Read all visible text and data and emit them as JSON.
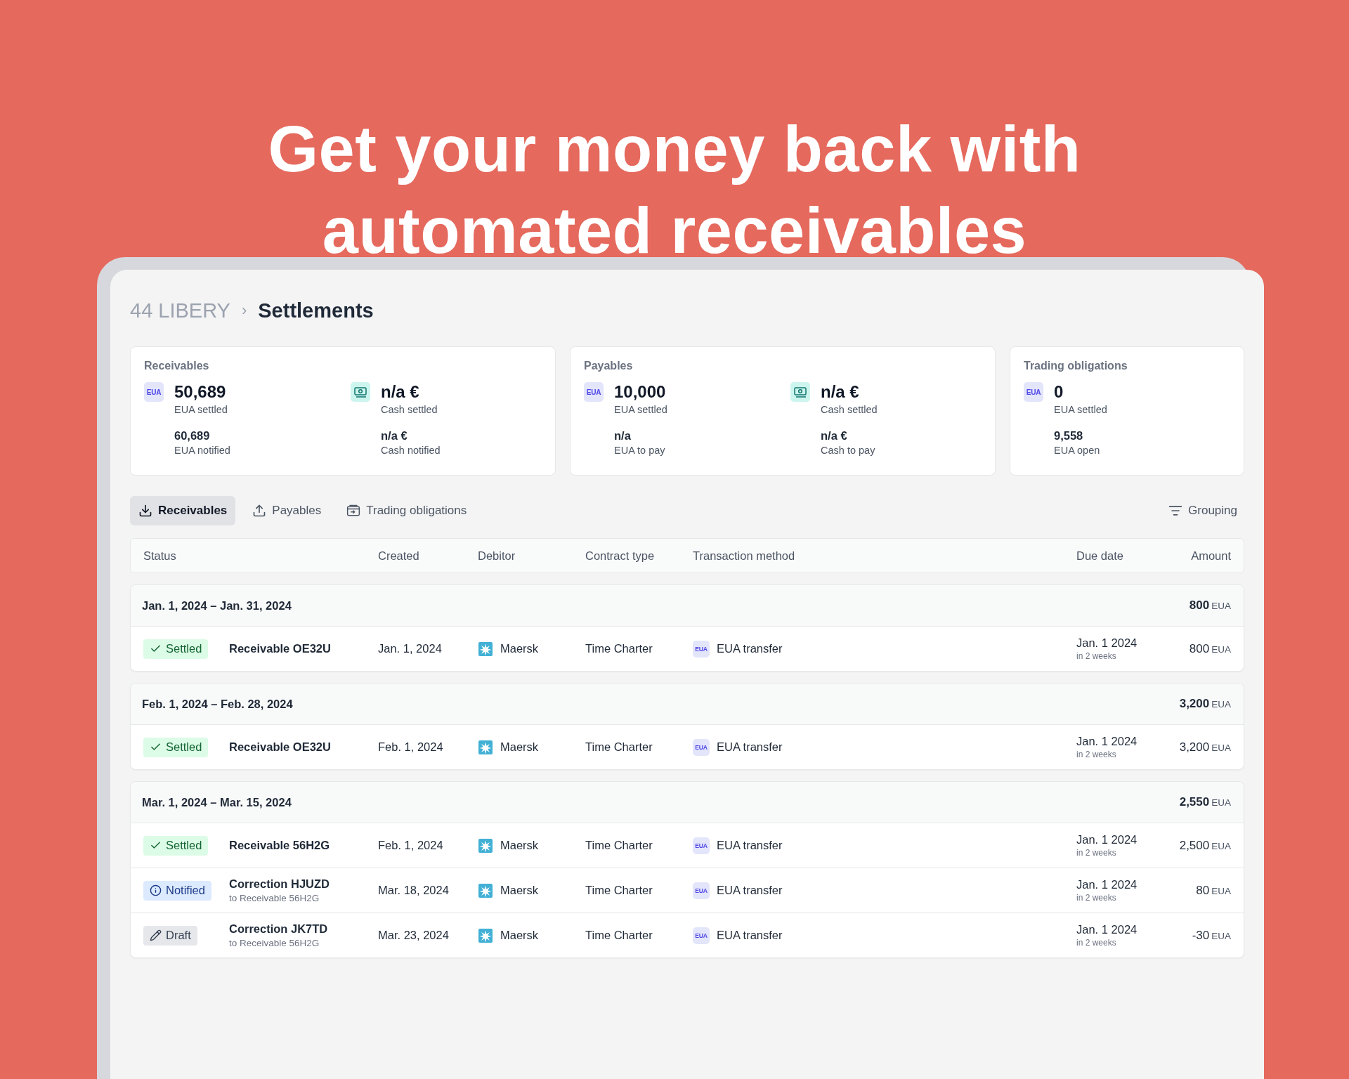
{
  "headline": [
    "Get your money back with",
    "automated receivables"
  ],
  "breadcrumb": {
    "parent": "44 LIBERY",
    "separator": "›",
    "current": "Settlements"
  },
  "summary_cards": [
    {
      "title": "Receivables",
      "metrics": [
        {
          "kind": "eua",
          "badge": "EUA",
          "value": "50,689",
          "label": "EUA settled",
          "sub_value": "60,689",
          "sub_label": "EUA notified"
        },
        {
          "kind": "cash",
          "value": "n/a €",
          "label": "Cash settled",
          "sub_value": "n/a €",
          "sub_label": "Cash notified"
        }
      ]
    },
    {
      "title": "Payables",
      "metrics": [
        {
          "kind": "eua",
          "badge": "EUA",
          "value": "10,000",
          "label": "EUA settled",
          "sub_value": "n/a",
          "sub_label": "EUA to pay"
        },
        {
          "kind": "cash",
          "value": "n/a €",
          "label": "Cash settled",
          "sub_value": "n/a €",
          "sub_label": "Cash to pay"
        }
      ]
    },
    {
      "title": "Trading obligations",
      "metrics": [
        {
          "kind": "eua",
          "badge": "EUA",
          "value": "0",
          "label": "EUA settled",
          "sub_value": "9,558",
          "sub_label": "EUA open"
        }
      ]
    }
  ],
  "tabs": [
    {
      "kind": "download",
      "label": "Receivables",
      "selected": true
    },
    {
      "kind": "upload",
      "label": "Payables",
      "selected": false
    },
    {
      "kind": "wallet",
      "label": "Trading obligations",
      "selected": false
    }
  ],
  "grouping_button": "Grouping",
  "table": {
    "columns": [
      "Status",
      "Created",
      "Debitor",
      "Contract type",
      "Transaction method",
      "Due date",
      "Amount"
    ],
    "groups": [
      {
        "period": "Jan. 1, 2024 – Jan. 31, 2024",
        "total": "800",
        "unit": "EUA",
        "rows": [
          {
            "status": {
              "kind": "settled",
              "label": "Settled"
            },
            "name": "Receivable OE32U",
            "created": "Jan. 1, 2024",
            "debitor": "Maersk",
            "contract_type": "Time Charter",
            "method_badge": "EUA",
            "method": "EUA transfer",
            "due": "Jan. 1 2024",
            "due_note": "in 2 weeks",
            "amount": "800",
            "unit": "EUA"
          }
        ]
      },
      {
        "period": "Feb. 1, 2024 – Feb. 28, 2024",
        "total": "3,200",
        "unit": "EUA",
        "rows": [
          {
            "status": {
              "kind": "settled",
              "label": "Settled"
            },
            "name": "Receivable OE32U",
            "created": "Feb. 1, 2024",
            "debitor": "Maersk",
            "contract_type": "Time Charter",
            "method_badge": "EUA",
            "method": "EUA transfer",
            "due": "Jan. 1 2024",
            "due_note": "in 2 weeks",
            "amount": "3,200",
            "unit": "EUA"
          }
        ]
      },
      {
        "period": "Mar. 1, 2024 – Mar. 15, 2024",
        "total": "2,550",
        "unit": "EUA",
        "rows": [
          {
            "status": {
              "kind": "settled",
              "label": "Settled"
            },
            "name": "Receivable 56H2G",
            "created": "Feb. 1, 2024",
            "debitor": "Maersk",
            "contract_type": "Time Charter",
            "method_badge": "EUA",
            "method": "EUA transfer",
            "due": "Jan. 1 2024",
            "due_note": "in 2 weeks",
            "amount": "2,500",
            "unit": "EUA"
          },
          {
            "status": {
              "kind": "notified",
              "label": "Notified"
            },
            "name": "Correction HJUZD",
            "reference": "to Receivable 56H2G",
            "created": "Mar. 18, 2024",
            "debitor": "Maersk",
            "contract_type": "Time Charter",
            "method_badge": "EUA",
            "method": "EUA transfer",
            "due": "Jan. 1 2024",
            "due_note": "in 2 weeks",
            "amount": "80",
            "unit": "EUA"
          },
          {
            "status": {
              "kind": "draft",
              "label": "Draft"
            },
            "name": "Correction JK7TD",
            "reference": "to Receivable 56H2G",
            "created": "Mar. 23, 2024",
            "debitor": "Maersk",
            "contract_type": "Time Charter",
            "method_badge": "EUA",
            "method": "EUA transfer",
            "due": "Jan. 1 2024",
            "due_note": "in 2 weeks",
            "amount": "-30",
            "unit": "EUA"
          }
        ]
      }
    ]
  }
}
